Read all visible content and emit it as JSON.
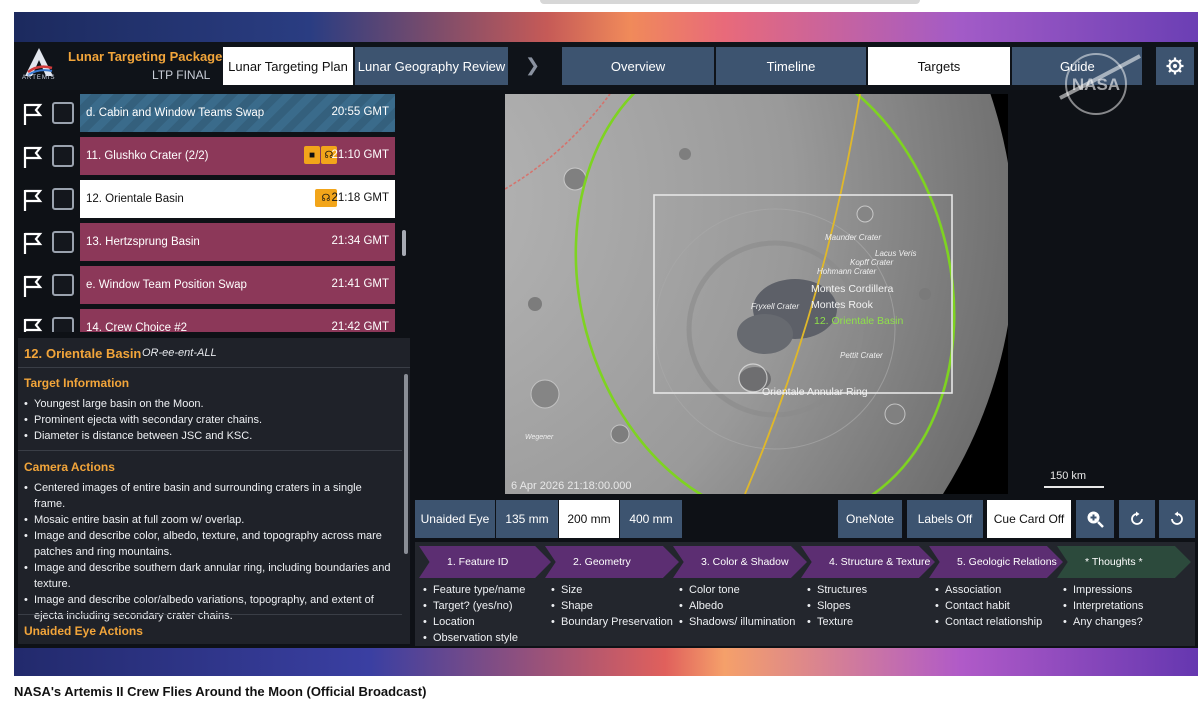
{
  "header": {
    "logo_text": "ARTEMIS",
    "package_title": "Lunar Targeting Package",
    "package_subtitle": "LTP FINAL",
    "plan_tabs": [
      "Lunar Targeting Plan",
      "Lunar Geography Review"
    ],
    "nav_tabs": [
      "Overview",
      "Timeline",
      "Targets",
      "Guide"
    ],
    "selected_nav_tab": "Targets",
    "brand_mark_text": "NASA"
  },
  "targets_list": [
    {
      "label": "d. Cabin and Window Teams Swap",
      "time": "20:55 GMT",
      "style": "teal"
    },
    {
      "label": "11. Glushko Crater (2/2)",
      "time": "21:10 GMT",
      "style": "maroon",
      "icons": [
        "camera-icon",
        "headset-icon"
      ]
    },
    {
      "label": "12. Orientale Basin",
      "time": "21:18 GMT",
      "style": "white",
      "icons": [
        "headset-icon"
      ]
    },
    {
      "label": "13. Hertzsprung Basin",
      "time": "21:34 GMT",
      "style": "maroon"
    },
    {
      "label": "e. Window Team Position Swap",
      "time": "21:41 GMT",
      "style": "maroon"
    },
    {
      "label": "14. Crew Choice #2",
      "time": "21:42 GMT",
      "style": "maroon"
    }
  ],
  "target_info": {
    "number": "12.",
    "name": "Orientale Basin",
    "pronunciation": "OR-ee-ent-ALL",
    "sections": [
      {
        "title": "Target Information",
        "items": [
          "Youngest large basin on the Moon.",
          "Prominent ejecta with secondary crater chains.",
          "Diameter is distance between JSC and KSC."
        ]
      },
      {
        "title": "Camera Actions",
        "items": [
          "Centered images of entire basin and surrounding craters in a single frame.",
          "Mosaic entire basin at full zoom w/ overlap.",
          "Image and describe color, albedo, texture, and topography across mare patches and ring mountains.",
          "Image and describe southern dark annular ring, including boundaries and texture.",
          "Image and describe color/albedo variations, topography, and extent of ejecta including secondary crater chains."
        ]
      },
      {
        "title": "Unaided Eye Actions",
        "items": []
      }
    ]
  },
  "map": {
    "labels": [
      "Maunder Crater",
      "Lacus Veris",
      "Kopff Crater",
      "Hohmann Crater",
      "Montes Cordillera",
      "Fryxell Crater",
      "Montes Rook",
      "12. Orientale Basin",
      "Pettit Crater",
      "Orientale Annular Ring",
      "Wegener"
    ],
    "timestamp": "6 Apr 2026 21:18:00.000",
    "scale_label": "150 km"
  },
  "controls": {
    "zoom_buttons": [
      "Unaided Eye",
      "135 mm",
      "200 mm",
      "400 mm"
    ],
    "selected_zoom": "200 mm",
    "onenote": "OneNote",
    "labels_toggle": "Labels Off",
    "cue_card_toggle": "Cue Card Off"
  },
  "workflow": [
    {
      "title": "1. Feature ID",
      "items": [
        "Feature type/name",
        "Target? (yes/no)",
        "Location",
        "Observation style"
      ]
    },
    {
      "title": "2. Geometry",
      "items": [
        "Size",
        "Shape",
        "Boundary Preservation"
      ]
    },
    {
      "title": "3. Color & Shadow",
      "items": [
        "Color tone",
        "Albedo",
        "Shadows/ illumination"
      ]
    },
    {
      "title": "4. Structure & Texture",
      "items": [
        "Structures",
        "Slopes",
        "Texture"
      ]
    },
    {
      "title": "5. Geologic Relations",
      "items": [
        "Association",
        "Contact habit",
        "Contact relationship"
      ]
    },
    {
      "title": "* Thoughts *",
      "items": [
        "Impressions",
        "Interpretations",
        "Any changes?"
      ]
    }
  ],
  "caption": "NASA's Artemis II Crew Flies Around the Moon (Official Broadcast)",
  "colors": {
    "accent_orange": "#f2a53a",
    "maroon_row": "#8c3859",
    "teal_row": "#3a6b8b",
    "button_blue": "#3d5470",
    "workflow_purple": "#5c2e72",
    "orbit_green": "#7ed321",
    "orbit_yellow": "#e0b82a"
  }
}
